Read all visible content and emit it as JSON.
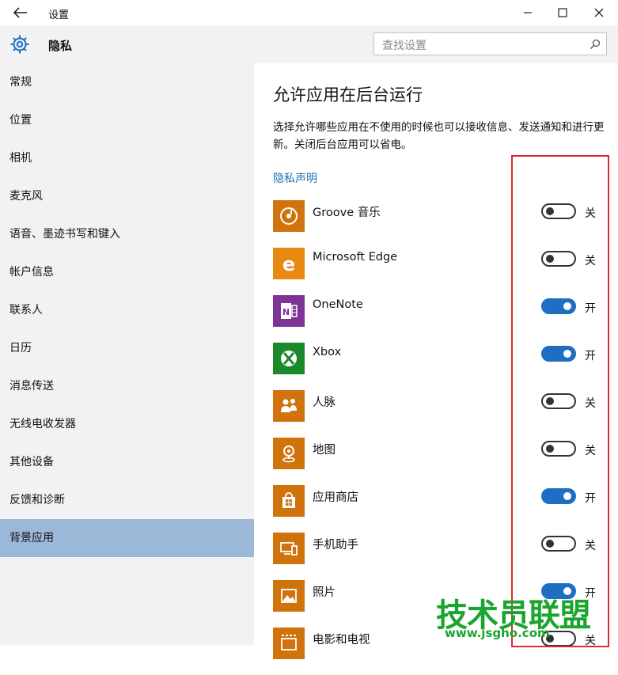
{
  "window": {
    "title": "设置"
  },
  "header": {
    "title": "隐私",
    "search_placeholder": "查找设置"
  },
  "sidebar": {
    "items": [
      {
        "label": "常规"
      },
      {
        "label": "位置"
      },
      {
        "label": "相机"
      },
      {
        "label": "麦克风"
      },
      {
        "label": "语音、墨迹书写和键入"
      },
      {
        "label": "帐户信息"
      },
      {
        "label": "联系人"
      },
      {
        "label": "日历"
      },
      {
        "label": "消息传送"
      },
      {
        "label": "无线电收发器"
      },
      {
        "label": "其他设备"
      },
      {
        "label": "反馈和诊断"
      },
      {
        "label": "背景应用",
        "active": true
      }
    ]
  },
  "main": {
    "title": "允许应用在后台运行",
    "description": "选择允许哪些应用在不使用的时候也可以接收信息、发送通知和进行更新。关闭后台应用可以省电。",
    "privacy_link": "隐私声明",
    "apps": [
      {
        "name": "Groove 音乐",
        "state": "关",
        "on": false,
        "color": "#d0730d",
        "icon": "groove-music-icon"
      },
      {
        "name": "Microsoft Edge",
        "state": "关",
        "on": false,
        "color": "#e8880e",
        "icon": "edge-icon"
      },
      {
        "name": "OneNote",
        "state": "开",
        "on": true,
        "color": "#7d3496",
        "icon": "onenote-icon"
      },
      {
        "name": "Xbox",
        "state": "开",
        "on": true,
        "color": "#198a2a",
        "icon": "xbox-icon"
      },
      {
        "name": "人脉",
        "state": "关",
        "on": false,
        "color": "#d0730d",
        "icon": "people-icon"
      },
      {
        "name": "地图",
        "state": "关",
        "on": false,
        "color": "#d0730d",
        "icon": "maps-icon"
      },
      {
        "name": "应用商店",
        "state": "开",
        "on": true,
        "color": "#d0730d",
        "icon": "store-icon"
      },
      {
        "name": "手机助手",
        "state": "关",
        "on": false,
        "color": "#d0730d",
        "icon": "phone-companion-icon"
      },
      {
        "name": "照片",
        "state": "开",
        "on": true,
        "color": "#d0730d",
        "icon": "photos-icon"
      },
      {
        "name": "电影和电视",
        "state": "关",
        "on": false,
        "color": "#d0730d",
        "icon": "movies-tv-icon"
      }
    ]
  },
  "watermark": {
    "text": "技术员联盟",
    "url": "www.jsgho.com"
  },
  "colors": {
    "accent": "#1e6fc4",
    "link": "#1e73b8",
    "nav_active": "#9cb8d8",
    "highlight": "#d92b2b"
  }
}
